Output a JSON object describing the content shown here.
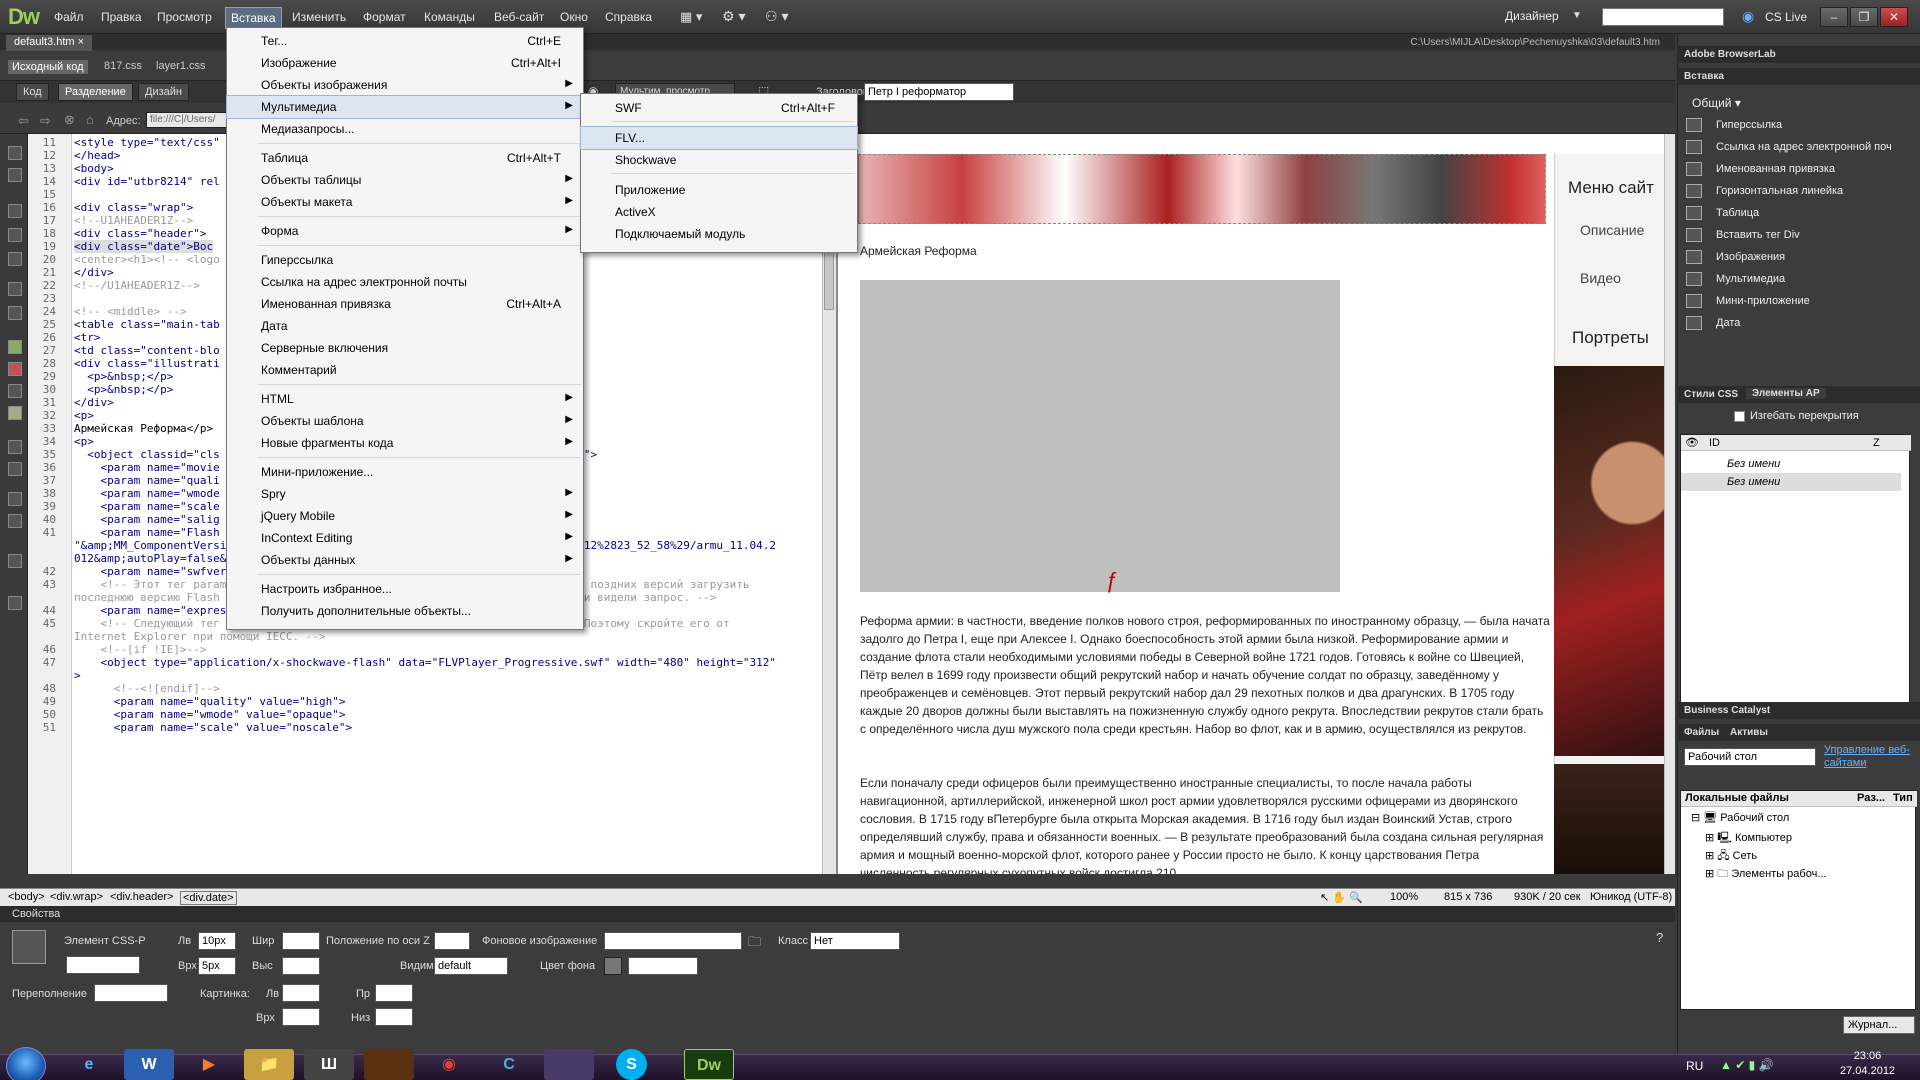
{
  "app": {
    "logo": "Dw",
    "menus": [
      "Файл",
      "Правка",
      "Просмотр",
      "Вставка",
      "Изменить",
      "Формат",
      "Команды",
      "Веб-сайт",
      "Окно",
      "Справка"
    ],
    "workspace": "Дизайнер",
    "cs_live": "CS Live",
    "window_buttons": [
      "–",
      "❐",
      "✕"
    ]
  },
  "document": {
    "tab": "default3.htm",
    "path": "C:\\Users\\MIJLA\\Desktop\\Pechenuyshka\\03\\default3.htm",
    "related": [
      "Исходный код",
      "817.css",
      "layer1.css"
    ],
    "views": [
      "Код",
      "Разделение",
      "Дизайн"
    ],
    "title_label": "Заголовок:",
    "title_value": "Петр I реформатор",
    "live_view": "Мультим. просмотр",
    "addr_label": "Адрес:",
    "addr_value": "file:///C|/Users/"
  },
  "code": {
    "lines": [
      {
        "n": "11",
        "t": "<style type=\"text/css\""
      },
      {
        "n": "12",
        "t": "</head>"
      },
      {
        "n": "13",
        "t": "<body>"
      },
      {
        "n": "14",
        "t": "<div id=\"utbr8214\" rel"
      },
      {
        "n": "15",
        "t": ""
      },
      {
        "n": "16",
        "t": "<div class=\"wrap\">"
      },
      {
        "n": "17",
        "t": "<!--U1AHEADER1Z-->"
      },
      {
        "n": "18",
        "t": "<div class=\"header\">"
      },
      {
        "n": "19",
        "t": "<div class=\"date\">Вос"
      },
      {
        "n": "20",
        "t": "<center><h1><!-- <logo"
      },
      {
        "n": "21",
        "t": "</div>"
      },
      {
        "n": "22",
        "t": "<!--/U1AHEADER1Z-->"
      },
      {
        "n": "23",
        "t": ""
      },
      {
        "n": "24",
        "t": "<!-- <middle> -->"
      },
      {
        "n": "25",
        "t": "<table class=\"main-tab"
      },
      {
        "n": "26",
        "t": "<tr>"
      },
      {
        "n": "27",
        "t": "<td class=\"content-blo"
      },
      {
        "n": "28",
        "t": "<div class=\"illustrati"
      },
      {
        "n": "29",
        "t": "  <p>&nbsp;</p>"
      },
      {
        "n": "30",
        "t": "  <p>&nbsp;</p>"
      },
      {
        "n": "31",
        "t": "</div>"
      },
      {
        "n": "32",
        "t": "<p>"
      },
      {
        "n": "33",
        "t": "Армейская Реформа</p>"
      },
      {
        "n": "34",
        "t": "<p>"
      },
      {
        "n": "35",
        "t": "  <object classid=\"cls                           \" height=\"312\" id=\"FLVPlayer\">"
      },
      {
        "n": "36",
        "t": "    <param name=\"movie"
      },
      {
        "n": "37",
        "t": "    <param name=\"quali"
      },
      {
        "n": "38",
        "t": "    <param name=\"wmode"
      },
      {
        "n": "39",
        "t": "    <param name=\"scale"
      },
      {
        "n": "40",
        "t": "    <param name=\"salig"
      },
      {
        "n": "41",
        "t": "    <param name=\"Flash"
      },
      {
        "n": "",
        "t": "\"&amp;MM_ComponentVersion=1&amp;skinName=Clear_Skin_3&amp;streamName=11.04.2012%2823_52_58%29/armu_11.04.2"
      },
      {
        "n": "",
        "t": "012&amp;autoPlay=false&amp;autoRewind=false\" />"
      },
      {
        "n": "42",
        "t": "    <param name=\"swfversion\" value=\"8,0,0,0\">"
      },
      {
        "n": "43",
        "t": "    <!-- Этот тег param предлагает пользователям Flash Player 6.0 r65 и более поздних версий загрузить"
      },
      {
        "n": "",
        "t": "последнюю версию Flash Player. Удалите его, если не хотите, чтобы пользователи видели запрос. -->"
      },
      {
        "n": "44",
        "t": "    <param name=\"expressinstall\" value=\"Scripts/expressInstall.swf\">"
      },
      {
        "n": "45",
        "t": "    <!-- Следующий тег object не поддерживается браузером Internet Explorer. Поэтому скройте его от"
      },
      {
        "n": "",
        "t": "Internet Explorer при помощи IECC. -->"
      },
      {
        "n": "46",
        "t": "    <!--[if !IE]>-->"
      },
      {
        "n": "47",
        "t": "    <object type=\"application/x-shockwave-flash\" data=\"FLVPlayer_Progressive.swf\" width=\"480\" height=\"312\""
      },
      {
        "n": "",
        "t": ">"
      },
      {
        "n": "48",
        "t": "      <!--<![endif]-->"
      },
      {
        "n": "49",
        "t": "      <param name=\"quality\" value=\"high\">"
      },
      {
        "n": "50",
        "t": "      <param name=\"wmode\" value=\"opaque\">"
      },
      {
        "n": "51",
        "t": "      <param name=\"scale\" value=\"noscale\">"
      }
    ]
  },
  "design": {
    "army_title": "Армейская Реформа",
    "paragraphs": [
      "Реформа армии: в частности, введение полков нового строя, реформированных по иностранному образцу, — была начата задолго до Петра I, еще при Алексее I. Однако боеспособность этой армии была низкой. Реформирование армии и создание флота стали необходимыми условиями победы в Северной войне 1721 годов. Готовясь к войне со Швецией, Пётр велел в 1699 году произвести общий рекрутский набор и начать обучение солдат по образцу, заведённому у преображенцев и семёновцев. Этот первый рекрутский набор дал 29 пехотных полков и два драгунских. В 1705 году каждые 20 дворов должны были выставлять на пожизненную службу одного рекрута. Впоследствии рекрутов стали брать с определённого числа душ мужского пола среди крестьян. Набор во флот, как и в армию, осуществлялся из рекрутов.",
      "Если поначалу среди офицеров были преимущественно иностранные специалисты, то после начала работы навигационной, артиллерийской, инженерной школ рост армии удовлетворялся русскими офицерами из дворянского сословия. В  1715 году вПетербурге была открыта Морская академия. В 1716 году был издан Воинский Устав, строго определявший службу, права и обязанности военных. — В результате преобразований была создана сильная регулярная армия и мощный военно-морской флот, которого ранее у России просто не было. К концу царствования Петра численность регулярных сухопутных войск достигла 210"
    ],
    "side_menu_title": "Меню сайт",
    "side_desc": "Описание",
    "side_video": "Видео",
    "side_portrets": "Портреты"
  },
  "statusbar": {
    "crumbs": [
      "<body>",
      "<div.wrap>",
      "<div.header>",
      "<div.date>"
    ],
    "zoom": "100%",
    "size": "815 x 736",
    "weight": "930K / 20 сек",
    "encoding": "Юникод (UTF-8)"
  },
  "properties": {
    "title": "Свойства",
    "element": "Элемент CSS-P",
    "left_label": "Лв",
    "left_value": "10px",
    "width_label": "Шир",
    "zpos_label": "Положение по оси Z",
    "bgimg_label": "Фоновое изображение",
    "class_label": "Класс",
    "class_value": "Нет",
    "top_label": "Врх",
    "top_value": "5px",
    "height_label": "Выс",
    "visibility_label": "Видимость",
    "visibility_value": "default",
    "bgcolor_label": "Цвет фона",
    "overflow_label": "Переполнение",
    "clip_label": "Картинка:",
    "clip_left": "Лв",
    "clip_right": "Пр",
    "clip_top": "Врх",
    "clip_bottom": "Низ"
  },
  "right_panel": {
    "browserlab": "Adobe BrowserLab",
    "insert": "Вставка",
    "category": "Общий",
    "insert_items": [
      "Гиперссылка",
      "Ссылка на адрес электронной поч",
      "Именованная привязка",
      "Горизонтальная линейка",
      "Таблица",
      "Вставить тег Div",
      "Изображения",
      "Мультимедиа",
      "Мини-приложение",
      "Дата"
    ],
    "css_tab": "Стили CSS",
    "ap_tab": "Элементы AP",
    "prevent_overlap": "Изгебать перекрытия",
    "ap_col_id": "ID",
    "ap_col_z": "Z",
    "ap_rows": [
      "Без имени",
      "Без имени"
    ],
    "business_catalyst": "Business Catalyst",
    "files_tab": "Файлы",
    "assets_tab": "Активы",
    "site_select": "Рабочий стол",
    "manage_sites": "Управление веб-сайтами",
    "local_files": "Локальные файлы",
    "col_size": "Раз...",
    "col_type": "Тип",
    "tree": [
      "Рабочий стол",
      "Компьютер",
      "Сеть",
      "Элементы рабоч..."
    ],
    "journal": "Журнал..."
  },
  "insert_menu": {
    "items": [
      {
        "label": "Тег...",
        "shortcut": "Ctrl+E",
        "arrow": ""
      },
      {
        "label": "Изображение",
        "shortcut": "Ctrl+Alt+I",
        "arrow": ""
      },
      {
        "label": "Объекты изображения",
        "shortcut": "",
        "arrow": "▶"
      },
      {
        "label": "Мультимедиа",
        "shortcut": "",
        "arrow": "▶"
      },
      {
        "label": "Медиазапросы...",
        "shortcut": "",
        "arrow": ""
      },
      {
        "label": "Таблица",
        "shortcut": "Ctrl+Alt+T",
        "arrow": ""
      },
      {
        "label": "Объекты таблицы",
        "shortcut": "",
        "arrow": "▶"
      },
      {
        "label": "Объекты макета",
        "shortcut": "",
        "arrow": "▶"
      },
      {
        "label": "Форма",
        "shortcut": "",
        "arrow": "▶"
      },
      {
        "label": "Гиперссылка",
        "shortcut": "",
        "arrow": ""
      },
      {
        "label": "Ссылка на адрес электронной почты",
        "shortcut": "",
        "arrow": ""
      },
      {
        "label": "Именованная привязка",
        "shortcut": "Ctrl+Alt+A",
        "arrow": ""
      },
      {
        "label": "Дата",
        "shortcut": "",
        "arrow": ""
      },
      {
        "label": "Серверные включения",
        "shortcut": "",
        "arrow": ""
      },
      {
        "label": "Комментарий",
        "shortcut": "",
        "arrow": ""
      },
      {
        "label": "HTML",
        "shortcut": "",
        "arrow": "▶"
      },
      {
        "label": "Объекты шаблона",
        "shortcut": "",
        "arrow": "▶"
      },
      {
        "label": "Новые фрагменты кода",
        "shortcut": "",
        "arrow": "▶"
      },
      {
        "label": "Мини-приложение...",
        "shortcut": "",
        "arrow": ""
      },
      {
        "label": "Spry",
        "shortcut": "",
        "arrow": "▶"
      },
      {
        "label": "jQuery Mobile",
        "shortcut": "",
        "arrow": "▶"
      },
      {
        "label": "InContext Editing",
        "shortcut": "",
        "arrow": "▶"
      },
      {
        "label": "Объекты данных",
        "shortcut": "",
        "arrow": "▶"
      },
      {
        "label": "Настроить избранное...",
        "shortcut": "",
        "arrow": ""
      },
      {
        "label": "Получить дополнительные объекты...",
        "shortcut": "",
        "arrow": ""
      }
    ]
  },
  "multimedia_menu": {
    "items": [
      {
        "label": "SWF",
        "shortcut": "Ctrl+Alt+F"
      },
      {
        "label": "FLV...",
        "shortcut": ""
      },
      {
        "label": "Shockwave",
        "shortcut": ""
      },
      {
        "label": "Приложение",
        "shortcut": ""
      },
      {
        "label": "ActiveX",
        "shortcut": ""
      },
      {
        "label": "Подключаемый модуль",
        "shortcut": ""
      }
    ]
  },
  "taskbar": {
    "apps": [
      "e",
      "W",
      "▶",
      "📁",
      "Ш",
      "",
      "◉",
      "C",
      "",
      "S",
      "Dw"
    ],
    "lang": "RU",
    "time": "23:06",
    "date": "27.04.2012"
  },
  "colors": {
    "dw_green": "#9ad05b",
    "menu_highlight": "#5b6b82",
    "dropdown_highlight": "#dce6f2"
  }
}
